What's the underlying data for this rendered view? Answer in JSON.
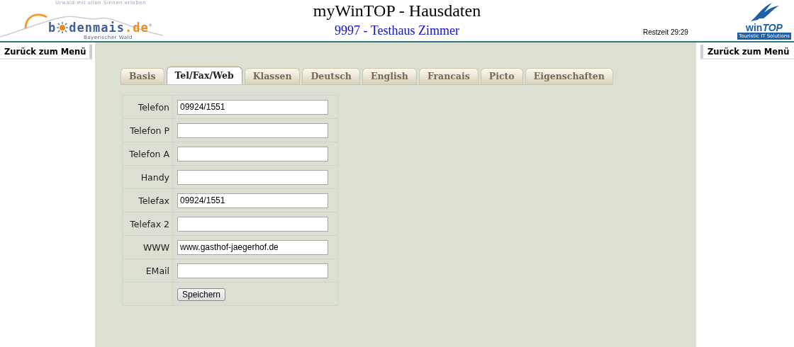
{
  "logo": {
    "tagline": "Urwald mit allen Sinnen erleben",
    "name_start": "b",
    "name_end": "denmais",
    "tld": ".de",
    "registered": "®",
    "subtitle": "Bayerischer Wald"
  },
  "header": {
    "title": "myWinTOP - Hausdaten",
    "subtitle": "9997 - Testhaus Zimmer",
    "remaining_time": "Restzeit 29:29"
  },
  "brand": {
    "name_start": "win",
    "name_end": "TOP",
    "slogan": "Touristic IT Solutions"
  },
  "nav_left": "Zurück zum Menü",
  "nav_right": "Zurück zum Menü",
  "tabs": [
    {
      "label": "Basis",
      "selected": false
    },
    {
      "label": "Tel/Fax/Web",
      "selected": true
    },
    {
      "label": "Klassen",
      "selected": false
    },
    {
      "label": "Deutsch",
      "selected": false
    },
    {
      "label": "English",
      "selected": false
    },
    {
      "label": "Francais",
      "selected": false
    },
    {
      "label": "Picto",
      "selected": false
    },
    {
      "label": "Eigenschaften",
      "selected": false
    }
  ],
  "fields": [
    {
      "label": "Telefon",
      "value": "09924/1551"
    },
    {
      "label": "Telefon P"
    },
    {
      "label": "Telefon A"
    },
    {
      "label": "Handy"
    },
    {
      "label": "Telefax",
      "value": "09924/1551"
    },
    {
      "label": "Telefax 2"
    },
    {
      "label": "WWW",
      "value": "www.gasthof-jaegerhof.de"
    },
    {
      "label": "EMail"
    }
  ],
  "save_button": "Speichern"
}
